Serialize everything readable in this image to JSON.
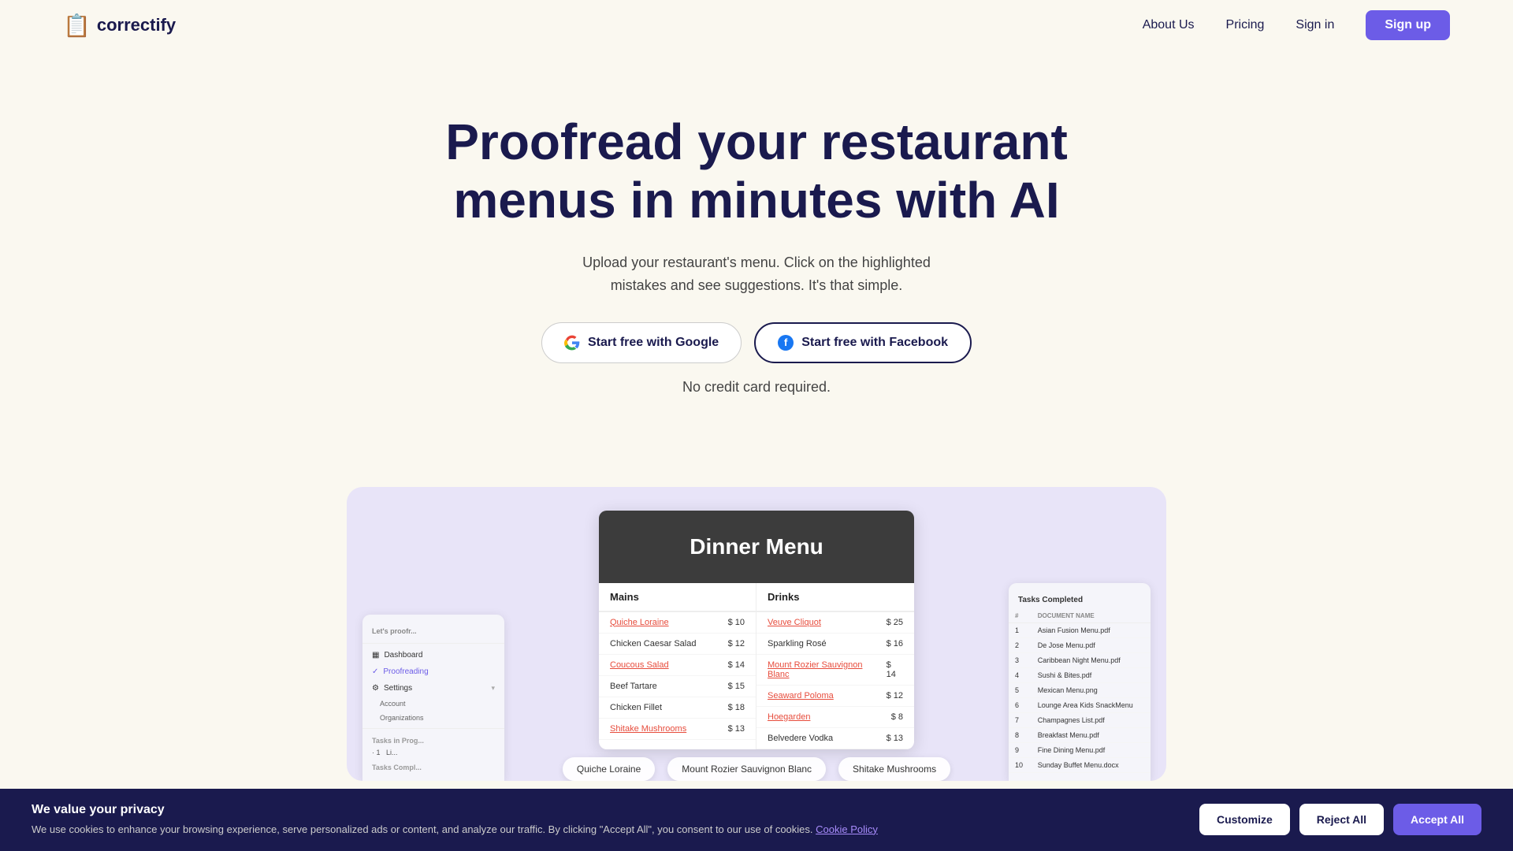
{
  "nav": {
    "logo_icon": "📋",
    "logo_text": "correctify",
    "links": [
      {
        "label": "About Us",
        "id": "about"
      },
      {
        "label": "Pricing",
        "id": "pricing"
      },
      {
        "label": "Sign in",
        "id": "signin"
      }
    ],
    "signup_label": "Sign up"
  },
  "hero": {
    "heading": "Proofread your restaurant menus in minutes with AI",
    "subtext": "Upload your restaurant's menu. Click on the highlighted mistakes and see suggestions. It's that simple.",
    "btn_google": "Start free with Google",
    "btn_facebook": "Start free with Facebook",
    "no_cc": "No credit card required."
  },
  "menu_card": {
    "title": "Dinner Menu",
    "mains_header": "Mains",
    "drinks_header": "Drinks",
    "mains": [
      {
        "name": "Quiche Loraine",
        "price": "$ 10",
        "linked": true
      },
      {
        "name": "Chicken Caesar Salad",
        "price": "$ 12",
        "linked": false
      },
      {
        "name": "Coucous Salad",
        "price": "$ 14",
        "linked": true
      },
      {
        "name": "Beef Tartare",
        "price": "$ 15",
        "linked": false
      },
      {
        "name": "Chicken Fillet",
        "price": "$ 18",
        "linked": false
      },
      {
        "name": "Shitake Mushrooms",
        "price": "$ 13",
        "linked": true
      }
    ],
    "drinks": [
      {
        "name": "Veuve Cliquot",
        "price": "$ 25",
        "linked": true
      },
      {
        "name": "Sparkling Rosé",
        "price": "$ 16",
        "linked": false
      },
      {
        "name": "Mount Rozier Sauvignon Blanc",
        "price": "$ 14",
        "linked": true
      },
      {
        "name": "Seaward Poloma",
        "price": "$ 12",
        "linked": true
      },
      {
        "name": "Hoegarden",
        "price": "$ 8",
        "linked": true
      },
      {
        "name": "Belvedere Vodka",
        "price": "$ 13",
        "linked": false
      }
    ]
  },
  "tags": [
    "Quiche Loraine",
    "Mount Rozier Sauvignon Blanc",
    "Shitake Mushrooms"
  ],
  "left_panel": {
    "header_text": "Let's proofr...",
    "items": [
      {
        "label": "Dashboard",
        "icon": "▦"
      },
      {
        "label": "Proofreading",
        "icon": "✓"
      },
      {
        "label": "Settings",
        "icon": "⚙",
        "has_sub": true
      }
    ],
    "sub_items": [
      "Account",
      "Organizations"
    ],
    "sections": [
      "Tasks in Prog...",
      "Tasks Compl..."
    ]
  },
  "right_panel": {
    "header": "Tasks Completed",
    "col1": "#",
    "col2": "DOCUMENT NAME",
    "rows": [
      {
        "num": "1",
        "name": "Asian Fusion Menu.pdf"
      },
      {
        "num": "2",
        "name": "De Jose Menu.pdf"
      },
      {
        "num": "3",
        "name": "Caribbean Night Menu.pdf"
      },
      {
        "num": "4",
        "name": "Sushi & Bites.pdf"
      },
      {
        "num": "5",
        "name": "Mexican Menu.png"
      },
      {
        "num": "6",
        "name": "Lounge Area Kids SnackMenu"
      },
      {
        "num": "7",
        "name": "Champagnes List.pdf"
      },
      {
        "num": "8",
        "name": "Breakfast Menu.pdf"
      },
      {
        "num": "9",
        "name": "Fine Dining Menu.pdf"
      },
      {
        "num": "10",
        "name": "Sunday Buffet Menu.docx"
      }
    ]
  },
  "cookie": {
    "title": "We value your privacy",
    "desc": "We use cookies to enhance your browsing experience, serve personalized ads or content, and analyze our traffic. By clicking \"Accept All\", you consent to our use of cookies.",
    "policy_link": "Cookie Policy",
    "btn_customize": "Customize",
    "btn_reject": "Reject All",
    "btn_accept": "Accept All"
  }
}
